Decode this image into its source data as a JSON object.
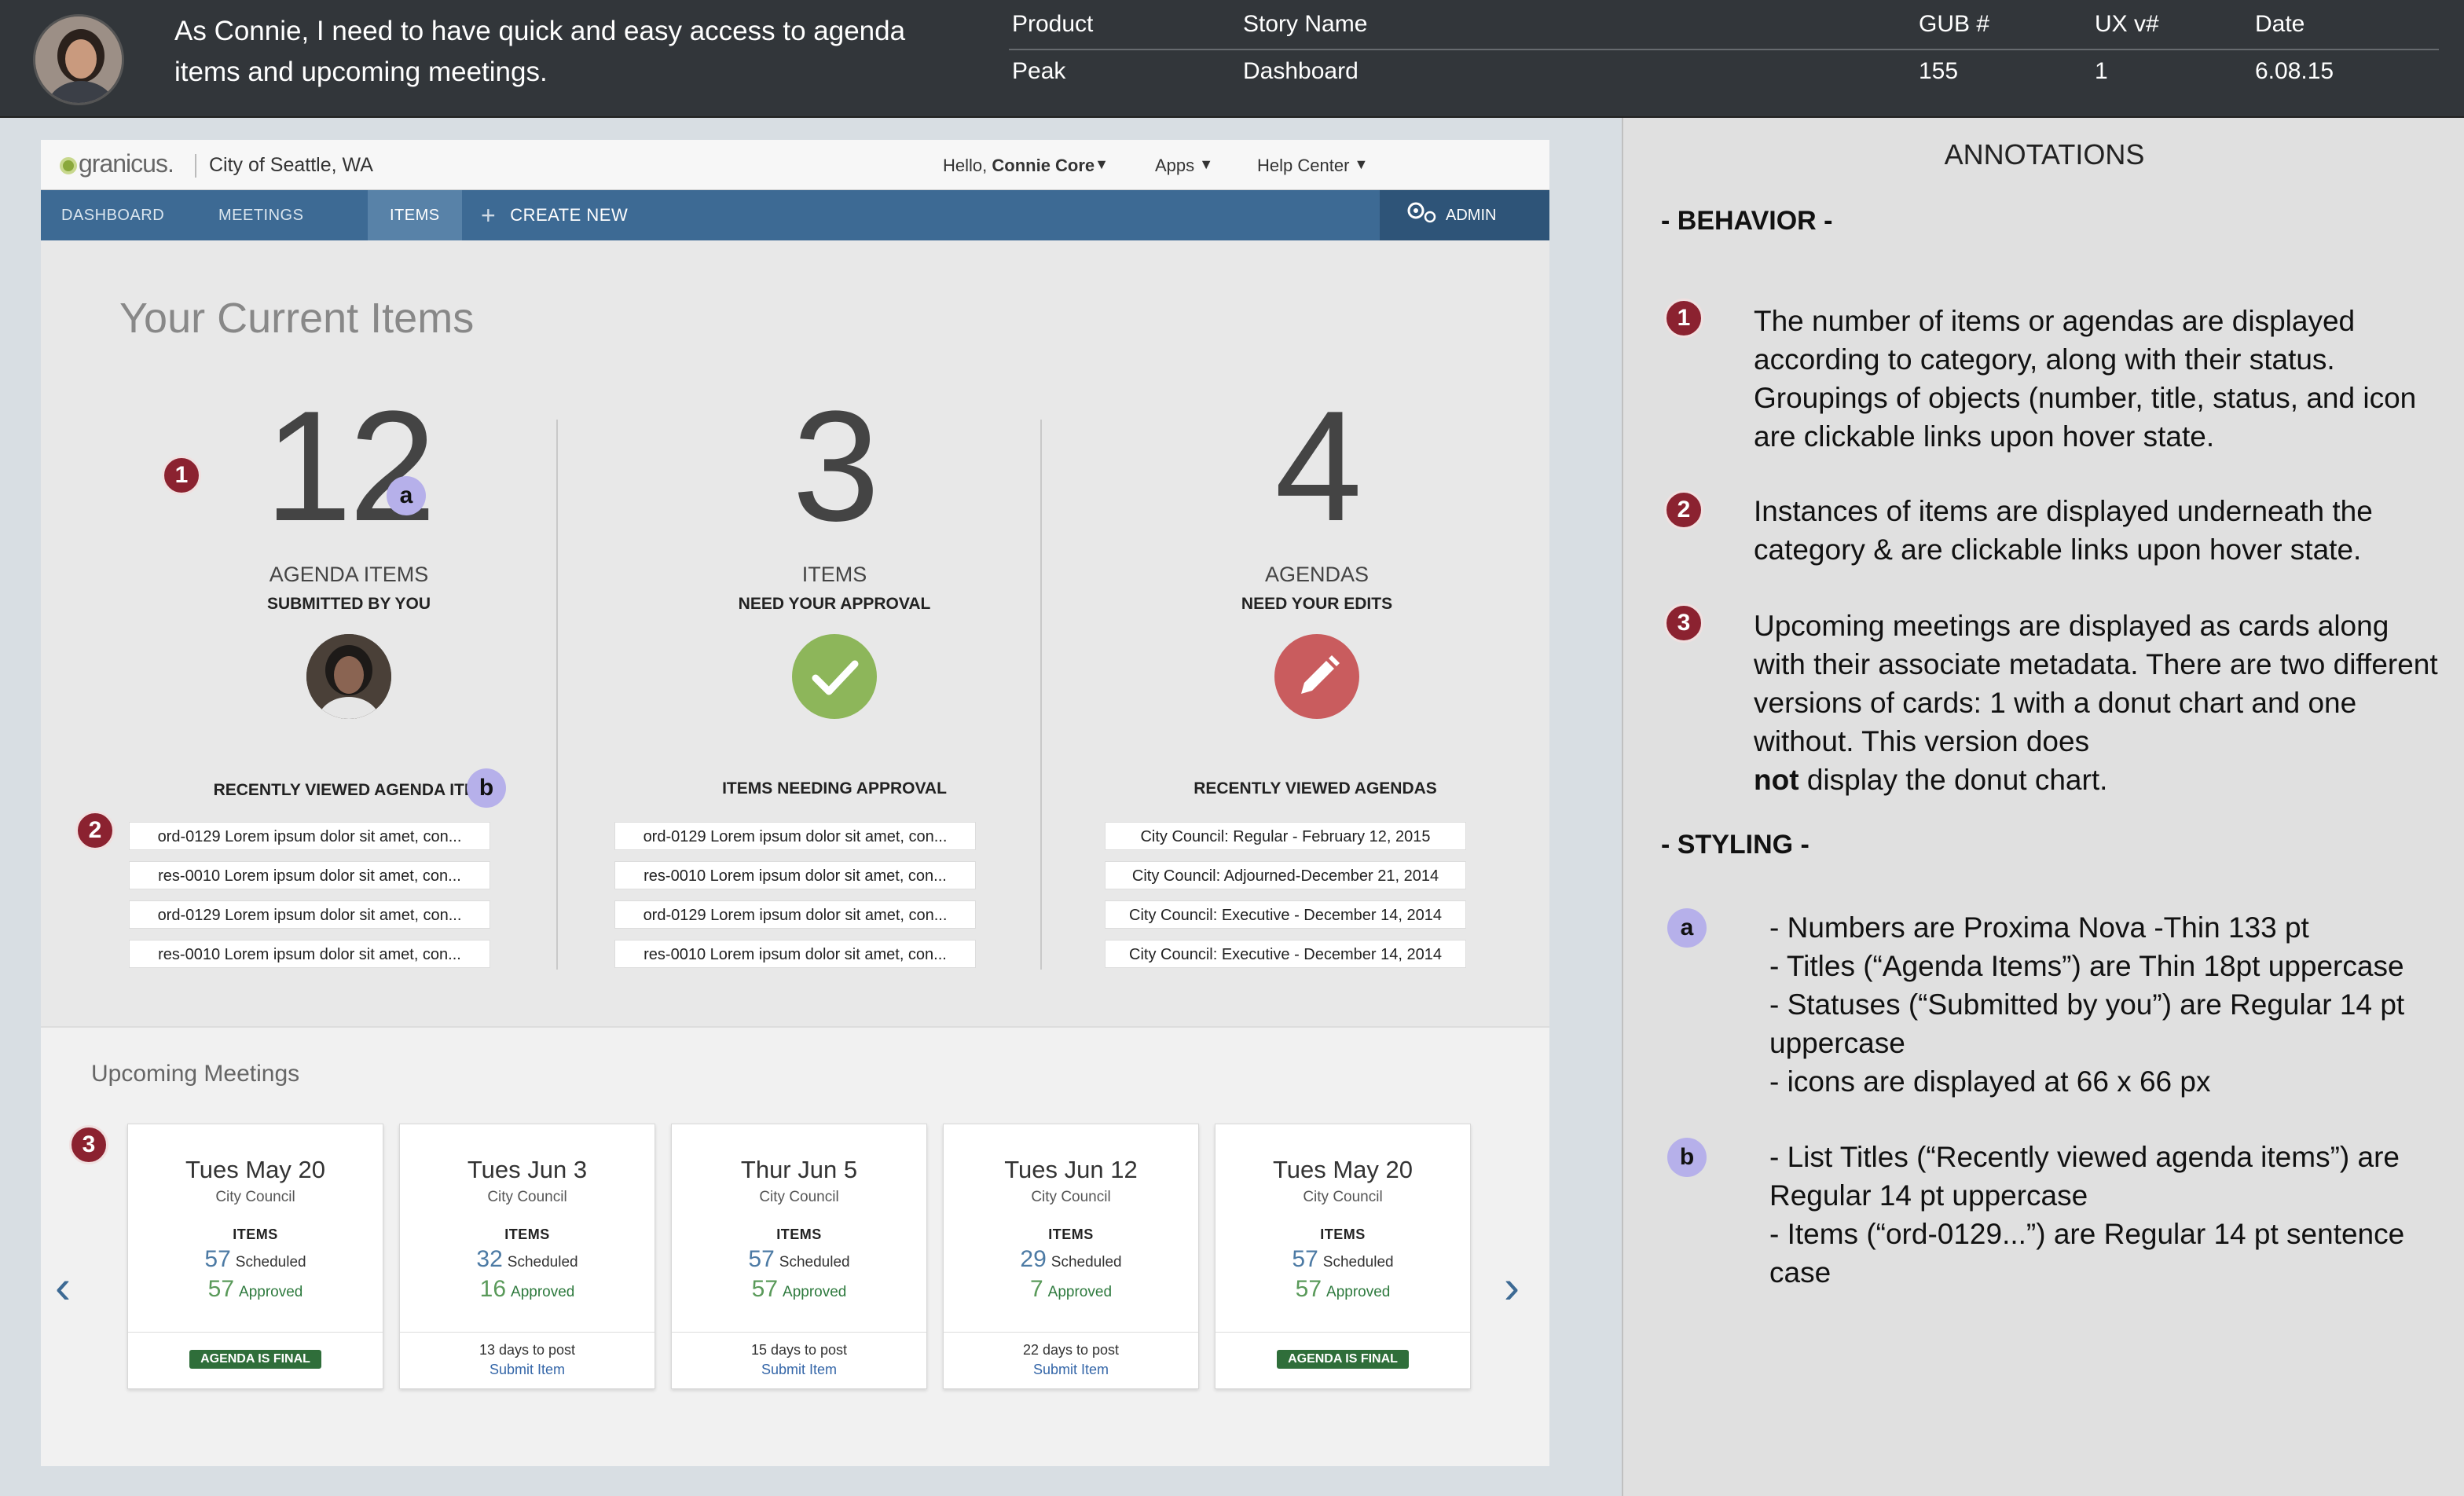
{
  "story": {
    "text": "As Connie, I need to have quick and easy access to agenda items and upcoming meetings.",
    "headers": {
      "product": "Product",
      "story_name": "Story Name",
      "gub": "GUB #",
      "ux": "UX v#",
      "date": "Date"
    },
    "values": {
      "product": "Peak",
      "story_name": "Dashboard",
      "gub": "155",
      "ux": "1",
      "date": "6.08.15"
    }
  },
  "app": {
    "logo": "granicus.",
    "org": "City of Seattle, WA",
    "hello": "Hello,",
    "user": "Connie Core",
    "apps": "Apps",
    "help": "Help Center",
    "nav": {
      "dashboard": "DASHBOARD",
      "meetings": "MEETINGS",
      "items": "ITEMS",
      "create": "CREATE NEW",
      "admin": "ADMIN"
    }
  },
  "current": {
    "title": "Your Current Items",
    "columns": [
      {
        "number": "12",
        "title": "AGENDA ITEMS",
        "status": "SUBMITTED BY YOU",
        "icon": "avatar",
        "list_title": "RECENTLY VIEWED AGENDA ITEMS",
        "list": [
          "ord-0129 Lorem ipsum dolor sit amet, con...",
          "res-0010 Lorem ipsum dolor sit amet, con...",
          "ord-0129 Lorem ipsum dolor sit amet, con...",
          "res-0010 Lorem ipsum dolor sit amet, con..."
        ]
      },
      {
        "number": "3",
        "title": "ITEMS",
        "status": "NEED YOUR APPROVAL",
        "icon": "check-icon",
        "list_title": "ITEMS NEEDING APPROVAL",
        "list": [
          "ord-0129 Lorem ipsum dolor sit amet, con...",
          "res-0010 Lorem ipsum dolor sit amet, con...",
          "ord-0129 Lorem ipsum dolor sit amet, con...",
          "res-0010 Lorem ipsum dolor sit amet, con..."
        ]
      },
      {
        "number": "4",
        "title": "AGENDAS",
        "status": "NEED YOUR EDITS",
        "icon": "pencil-icon",
        "list_title": "RECENTLY VIEWED AGENDAS",
        "list": [
          "City Council: Regular - February 12, 2015",
          "City Council: Adjourned-December 21, 2014",
          "City Council: Executive - December 14, 2014",
          "City Council: Executive - December 14, 2014"
        ]
      }
    ]
  },
  "upcoming": {
    "title": "Upcoming Meetings",
    "items_label": "ITEMS",
    "scheduled_label": "Scheduled",
    "approved_label": "Approved",
    "cards": [
      {
        "date": "Tues May 20",
        "org": "City Council",
        "scheduled": "57",
        "approved": "57",
        "final": "AGENDA IS FINAL",
        "days": "",
        "link": ""
      },
      {
        "date": "Tues Jun 3",
        "org": "City Council",
        "scheduled": "32",
        "approved": "16",
        "final": "",
        "days": "13 days to post",
        "link": "Submit Item"
      },
      {
        "date": "Thur Jun 5",
        "org": "City Council",
        "scheduled": "57",
        "approved": "57",
        "final": "",
        "days": "15 days to post",
        "link": "Submit Item"
      },
      {
        "date": "Tues Jun 12",
        "org": "City Council",
        "scheduled": "29",
        "approved": "7",
        "final": "",
        "days": "22 days to post",
        "link": "Submit Item"
      },
      {
        "date": "Tues May 20",
        "org": "City Council",
        "scheduled": "57",
        "approved": "57",
        "final": "AGENDA IS FINAL",
        "days": "",
        "link": ""
      }
    ]
  },
  "annotations": {
    "title": "ANNOTATIONS",
    "behavior": "- BEHAVIOR -",
    "styling": "- STYLING -",
    "b1": "The number of items or agendas are displayed according to category, along with their status. Groupings of objects (number, title, status, and icon are clickable links upon hover state.",
    "b2": "Instances of items are displayed underneath the category & are clickable links upon hover state.",
    "b3_pre": "Upcoming meetings are displayed as cards along with their associate metadata. There are two different versions of cards: 1 with a donut chart and one without. This version does",
    "b3_bold": "not",
    "b3_post": "display the donut chart.",
    "sa": [
      "- Numbers are Proxima Nova -Thin 133 pt",
      "- Titles (“Agenda Items”) are Thin 18pt uppercase",
      "- Statuses (“Submitted by you”) are Regular 14 pt uppercase",
      "- icons are displayed at 66 x 66 px"
    ],
    "sb": [
      "- List Titles (“Recently viewed agenda items”) are Regular 14 pt uppercase",
      "- Items (“ord-0129...”) are Regular 14 pt sentence case"
    ]
  },
  "markers": {
    "one": "1",
    "two": "2",
    "three": "3",
    "a": "a",
    "b": "b"
  },
  "colors": {
    "nav": "#3d6a94",
    "approve_green": "#8db65a",
    "edit_red": "#c95c5e",
    "marker_red": "#8b2230",
    "marker_lavender": "#b6b0ea"
  }
}
